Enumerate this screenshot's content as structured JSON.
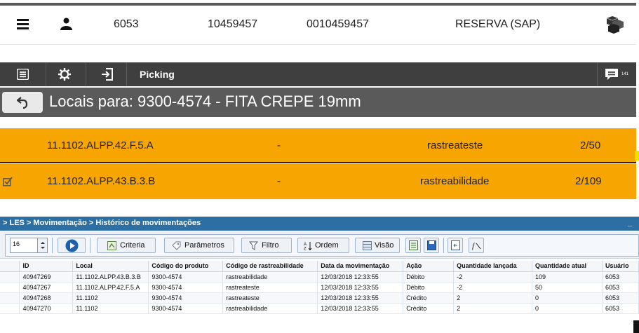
{
  "info_bar": {
    "code": "6053",
    "number": "10459457",
    "padded_number": "0010459457",
    "reservation": "RESERVA (SAP)"
  },
  "picking": {
    "toolbar_title": "Picking",
    "notification_count": "141",
    "header_title": "Locais para: 9300-4574 - FITA CREPE 19mm",
    "rows": [
      {
        "location": "11.1102.ALPP.42.F.5.A",
        "separator": "-",
        "trace": "rastreateste",
        "qty": "2/50",
        "checked": false
      },
      {
        "location": "11.1102.ALPP.43.B.3.B",
        "separator": "-",
        "trace": "rastreabilidade",
        "qty": "2/109",
        "checked": true
      }
    ]
  },
  "les": {
    "breadcrumb": "> LES > Movimentação > Histórico de movimentações",
    "minimize": "_",
    "spinner_value": "16",
    "buttons": {
      "criteria": "Criteria",
      "parametros": "Parâmetros",
      "filtro": "Filtro",
      "ordem": "Ordem",
      "visao": "Visão"
    },
    "columns": [
      "ID",
      "Local",
      "Código do produto",
      "Código de rastreabilidade",
      "Data da movimentação",
      "Ação",
      "Quantidade lançada",
      "Quantidade atual",
      "Usuário"
    ],
    "rows": [
      [
        "40947269",
        "11.1102.ALPP.43.B.3.B",
        "9300-4574",
        "rastreabilidade",
        "12/03/2018 12:33:55",
        "Débito",
        "-2",
        "109",
        "6053"
      ],
      [
        "40947267",
        "11.1102.ALPP.42.F.5.A",
        "9300-4574",
        "rastreateste",
        "12/03/2018 12:33:55",
        "Débito",
        "-2",
        "50",
        "6053"
      ],
      [
        "40947268",
        "11.1102",
        "9300-4574",
        "rastreateste",
        "12/03/2018 12:33:55",
        "Crédito",
        "2",
        "0",
        "6053"
      ],
      [
        "40947270",
        "11.1102",
        "9300-4574",
        "rastreabilidade",
        "12/03/2018 12:33:55",
        "Crédito",
        "2",
        "0",
        "6053"
      ]
    ]
  }
}
